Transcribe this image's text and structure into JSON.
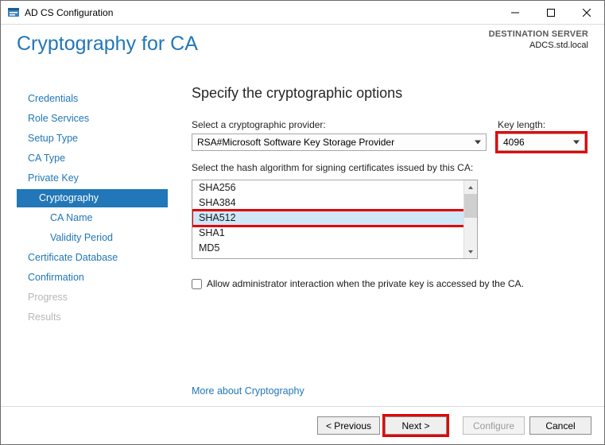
{
  "titlebar": {
    "title": "AD CS Configuration"
  },
  "header": {
    "heading": "Cryptography for CA",
    "dest_label": "DESTINATION SERVER",
    "dest_host": "ADCS.std.local"
  },
  "nav": {
    "items": [
      {
        "label": "Credentials",
        "level": 0,
        "active": false,
        "disabled": false
      },
      {
        "label": "Role Services",
        "level": 0,
        "active": false,
        "disabled": false
      },
      {
        "label": "Setup Type",
        "level": 0,
        "active": false,
        "disabled": false
      },
      {
        "label": "CA Type",
        "level": 0,
        "active": false,
        "disabled": false
      },
      {
        "label": "Private Key",
        "level": 0,
        "active": false,
        "disabled": false
      },
      {
        "label": "Cryptography",
        "level": 1,
        "active": true,
        "disabled": false
      },
      {
        "label": "CA Name",
        "level": 2,
        "active": false,
        "disabled": false
      },
      {
        "label": "Validity Period",
        "level": 2,
        "active": false,
        "disabled": false
      },
      {
        "label": "Certificate Database",
        "level": 0,
        "active": false,
        "disabled": false
      },
      {
        "label": "Confirmation",
        "level": 0,
        "active": false,
        "disabled": false
      },
      {
        "label": "Progress",
        "level": 0,
        "active": false,
        "disabled": true
      },
      {
        "label": "Results",
        "level": 0,
        "active": false,
        "disabled": true
      }
    ]
  },
  "content": {
    "heading": "Specify the cryptographic options",
    "provider_label": "Select a cryptographic provider:",
    "provider_value": "RSA#Microsoft Software Key Storage Provider",
    "keylen_label": "Key length:",
    "keylen_value": "4096",
    "hash_label": "Select the hash algorithm for signing certificates issued by this CA:",
    "hash_options": [
      "SHA256",
      "SHA384",
      "SHA512",
      "SHA1",
      "MD5"
    ],
    "hash_selected": "SHA512",
    "allow_admin_label": "Allow administrator interaction when the private key is accessed by the CA.",
    "more_link": "More about Cryptography"
  },
  "footer": {
    "previous": "< Previous",
    "next": "Next >",
    "configure": "Configure",
    "cancel": "Cancel"
  }
}
